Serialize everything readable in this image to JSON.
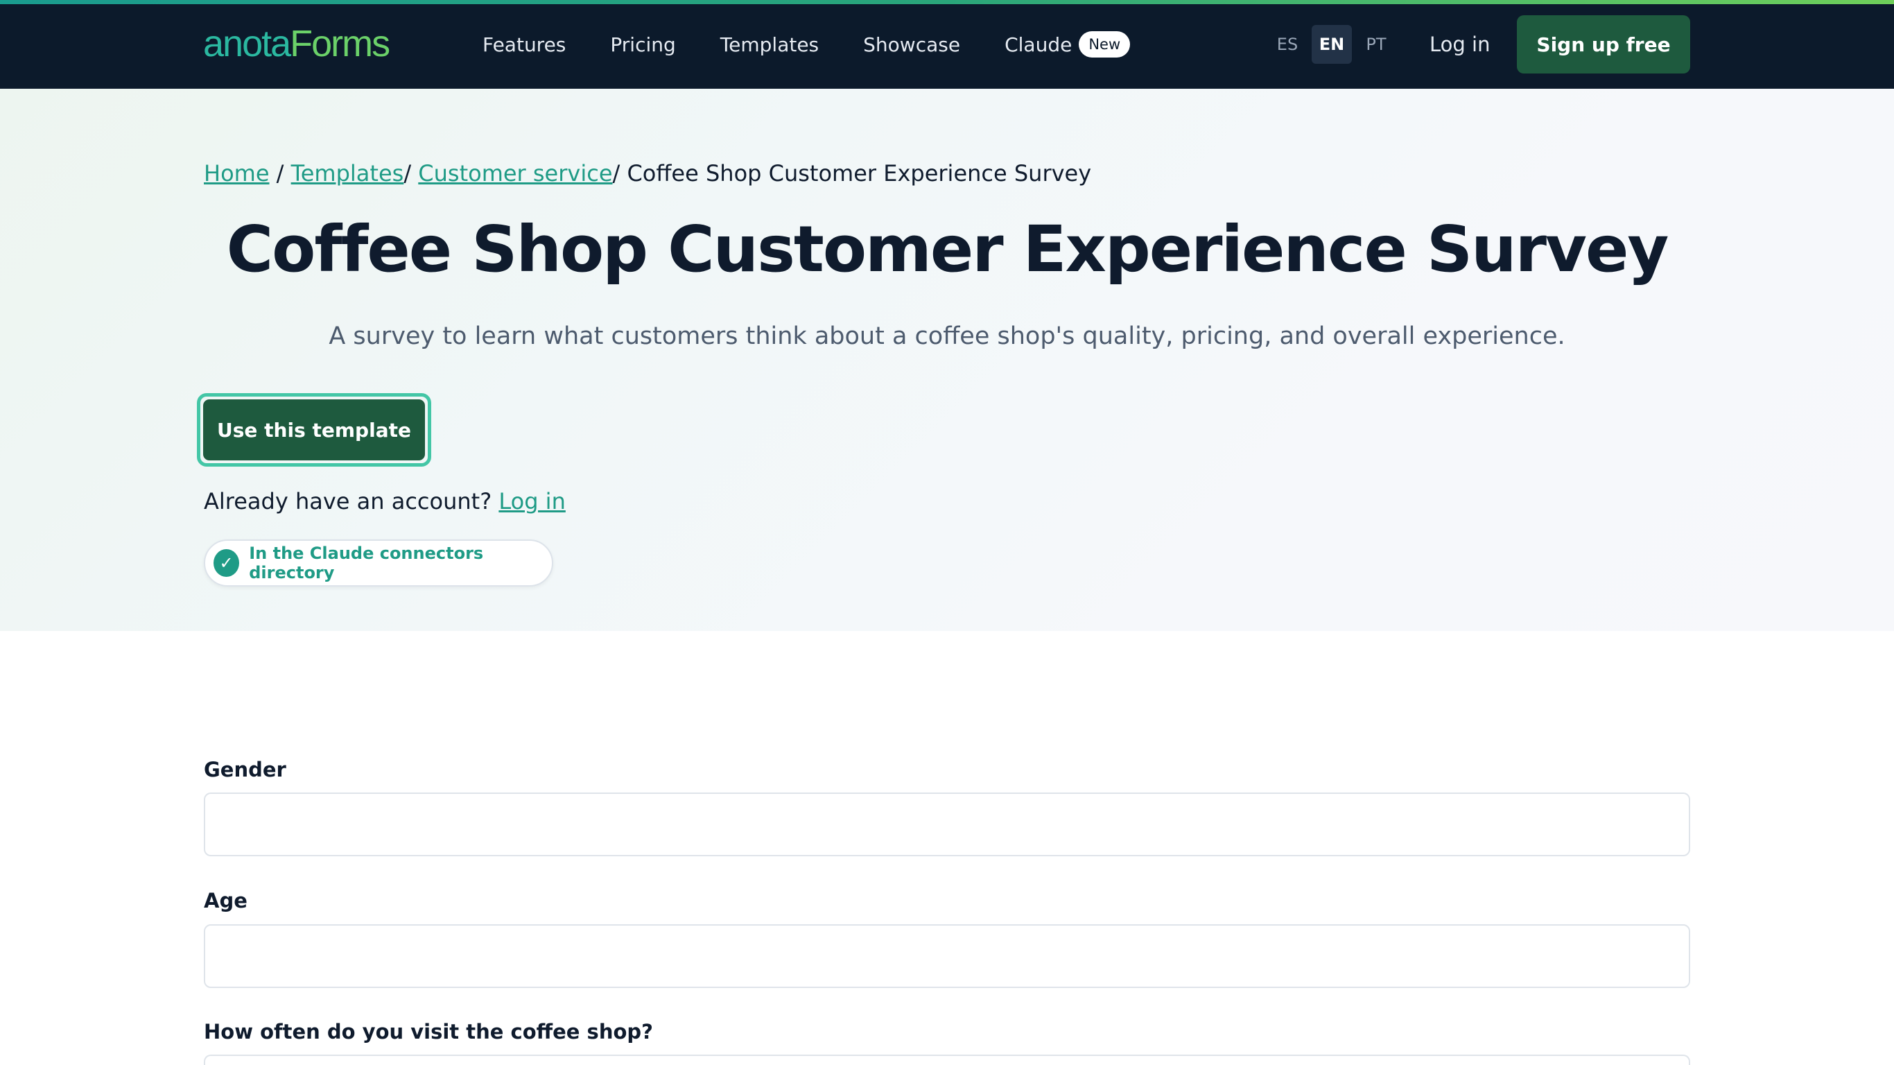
{
  "header": {
    "logo_part1": "anota",
    "logo_part2": "Forms",
    "nav": [
      {
        "label": "Features"
      },
      {
        "label": "Pricing"
      },
      {
        "label": "Templates"
      },
      {
        "label": "Showcase"
      },
      {
        "label": "Claude",
        "badge": "New"
      }
    ],
    "languages": [
      {
        "code": "ES",
        "active": false
      },
      {
        "code": "EN",
        "active": true
      },
      {
        "code": "PT",
        "active": false
      }
    ],
    "login_label": "Log in",
    "signup_label": "Sign up free"
  },
  "breadcrumb": {
    "home": "Home",
    "sep1": " / ",
    "templates": "Templates",
    "sep2": "/ ",
    "category": "Customer service",
    "sep3": "/ ",
    "current": "Coffee Shop Customer Experience Survey"
  },
  "hero": {
    "title": "Coffee Shop Customer Experience Survey",
    "subtitle": "A survey to learn what customers think about a coffee shop's quality, pricing, and overall experience.",
    "use_template_label": "Use this template",
    "already_text": "Already have an account? ",
    "already_login": "Log in",
    "claude_directory": "In the Claude connectors directory",
    "check_glyph": "✓"
  },
  "form": {
    "fields": [
      {
        "label": "Gender",
        "value": ""
      },
      {
        "label": "Age",
        "value": ""
      },
      {
        "label": "How often do you visit the coffee shop?",
        "value": ""
      }
    ]
  },
  "colors": {
    "nav_bg": "#0c1a2b",
    "brand_green": "#1e5a3e",
    "accent_teal": "#1f9b86"
  }
}
